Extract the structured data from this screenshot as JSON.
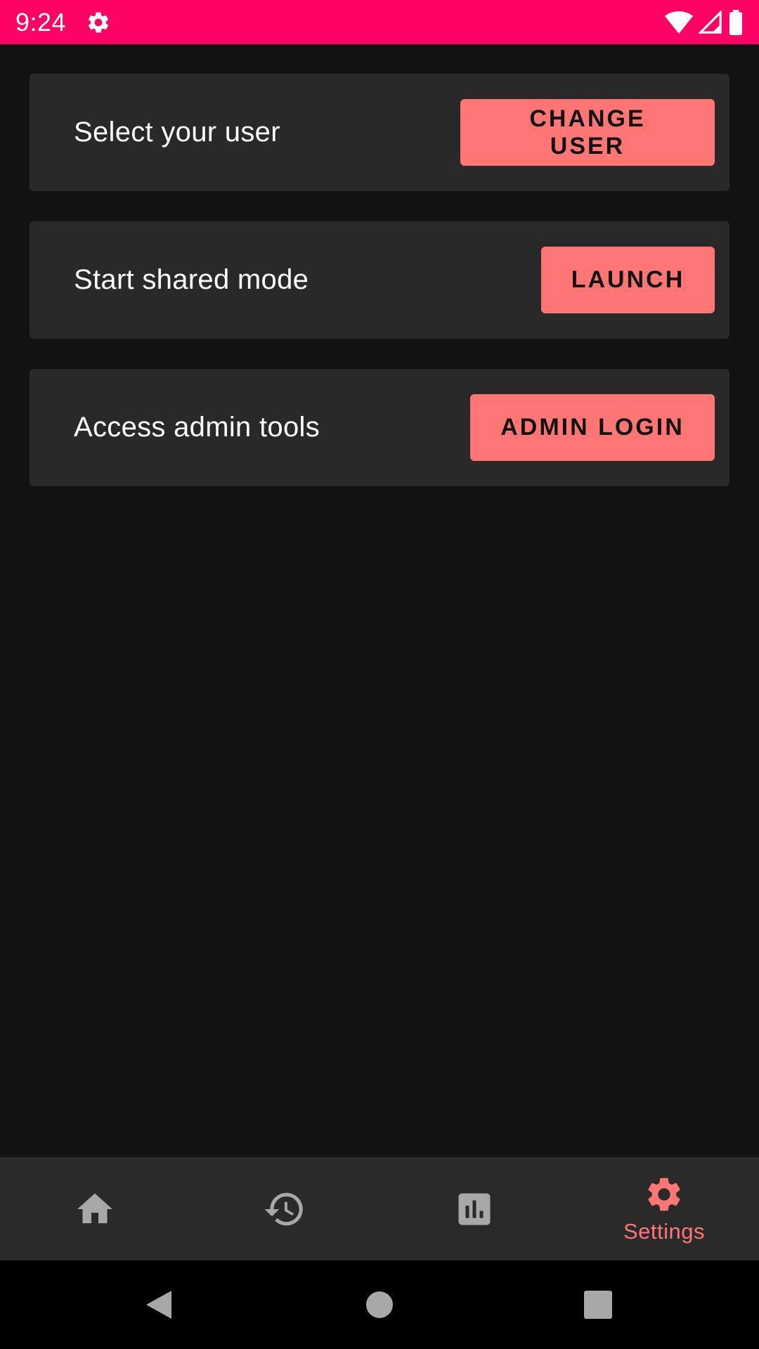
{
  "status_bar": {
    "time": "9:24",
    "icons": [
      "gear-icon",
      "wifi-icon",
      "signal-icon",
      "battery-icon"
    ]
  },
  "cards": [
    {
      "label": "Select your user",
      "button": "CHANGE USER"
    },
    {
      "label": "Start shared mode",
      "button": "LAUNCH"
    },
    {
      "label": "Access admin tools",
      "button": "ADMIN LOGIN"
    }
  ],
  "bottom_nav": {
    "items": [
      {
        "icon": "home-icon",
        "label": ""
      },
      {
        "icon": "history-icon",
        "label": ""
      },
      {
        "icon": "bar-chart-icon",
        "label": ""
      },
      {
        "icon": "settings-icon",
        "label": "Settings",
        "active": true
      }
    ]
  },
  "system_nav": [
    "back-icon",
    "home-circle-icon",
    "recents-icon"
  ],
  "colors": {
    "status_bar": "#ff0266",
    "accent": "#ff7675",
    "background": "#121212",
    "card": "#292929",
    "nav_bar": "#2a2a2a",
    "inactive_icon": "#a8a8a8"
  }
}
